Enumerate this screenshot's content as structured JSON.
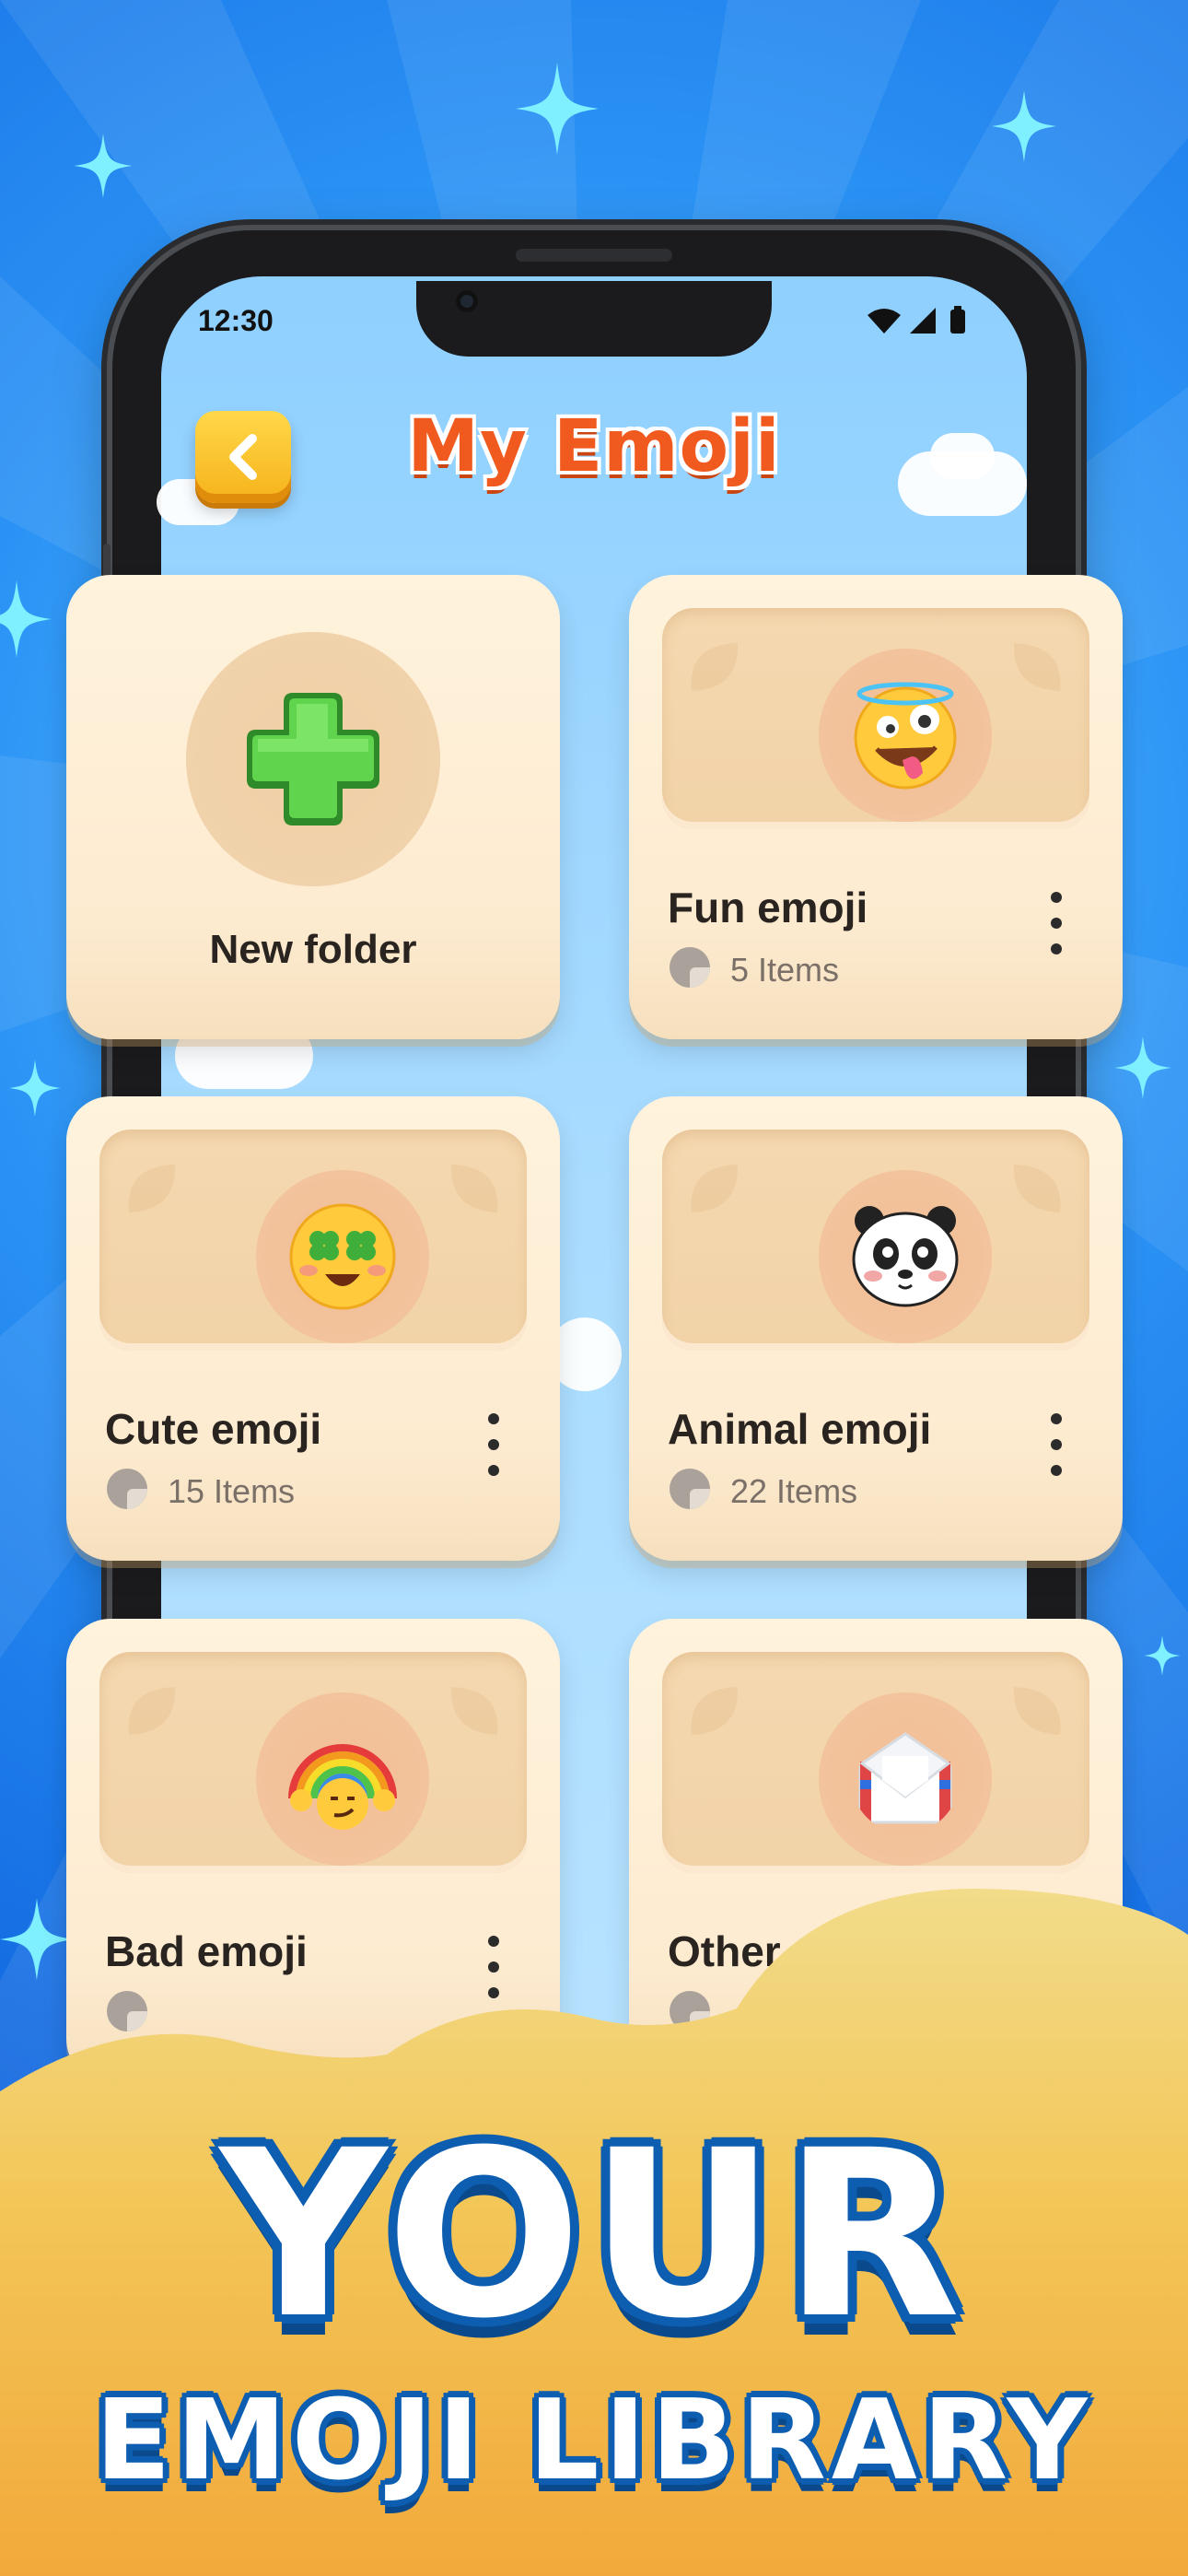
{
  "status_bar": {
    "time": "12:30"
  },
  "header": {
    "title": "My Emoji",
    "back_icon": "chevron-left-icon"
  },
  "new_folder": {
    "label": "New folder",
    "icon": "plus-icon"
  },
  "folders": [
    {
      "name": "Fun emoji",
      "count": "5 Items",
      "emoji": "zany-face"
    },
    {
      "name": "Cute emoji",
      "count": "15 Items",
      "emoji": "clover-eyes-face"
    },
    {
      "name": "Animal emoji",
      "count": "22 Items",
      "emoji": "panda-face"
    },
    {
      "name": "Bad emoji",
      "count": "",
      "emoji": "rainbow-smirk-face"
    },
    {
      "name": "Other em",
      "count": "",
      "emoji": "envelope"
    }
  ],
  "banner": {
    "line1": "YOUR",
    "line2": "EMOJI LIBRARY"
  },
  "colors": {
    "title": "#f15a1e",
    "card": "#fdebd0",
    "banner_text_outline": "#0d5db0",
    "band": "#f3c04a"
  }
}
